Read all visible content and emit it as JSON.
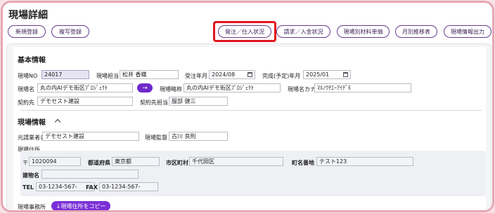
{
  "page": {
    "title": "現場詳細"
  },
  "left_buttons": {
    "new": "新規登録",
    "copy": "複写登録"
  },
  "right_buttons": {
    "order": "発注／仕入状況",
    "billing": "請求／入金状況",
    "material_price": "現場別材料単価",
    "monthly": "月別推移表",
    "export": "現場情報出力"
  },
  "basic": {
    "section_title": "基本情報",
    "site_no_label": "現場NO",
    "site_no": "24017",
    "manager_label": "現場担当",
    "manager": "松井 香織",
    "order_month_label": "受注年月",
    "order_month": "2024/08",
    "complete_label": "完成(予定)年月",
    "complete": "2025/01",
    "name_label": "現場名",
    "name": "丸の内AIデモ街区ﾌﾟﾛｼﾞｪｸﾄ",
    "arrow": "→",
    "abbr_label": "現場略称",
    "abbr": "丸の内AIデモ街区ﾌﾟﾛｼﾞｪｸﾄ",
    "kana_label": "現場名カナ",
    "kana": "ﾏﾙﾉｳﾁｴｰｱｲﾃﾞﾓ",
    "client_label": "契約先",
    "client": "デモセスト建設",
    "client_contact_label": "契約先担当",
    "client_contact": "服部 健三"
  },
  "site": {
    "section_title": "現場情報",
    "contractor_label": "元請業者名",
    "contractor": "デモセスト建設",
    "supervisor_label": "現場監督",
    "supervisor": "古川 良則",
    "address_label": "現場住所",
    "zip_label": "〒",
    "zip": "1020094",
    "pref_label": "都道府県",
    "pref": "東京都",
    "city_label": "市区町村",
    "city": "千代田区",
    "street_label": "町名番地",
    "street": "テスト123",
    "building_label": "建物名",
    "building": "",
    "tel_label": "TEL",
    "tel": "03-1234-567-",
    "fax_label": "FAX",
    "fax": "03-1234-567-",
    "office_label": "現場事務所",
    "copy_button": "↓現場住所をコピー"
  }
}
